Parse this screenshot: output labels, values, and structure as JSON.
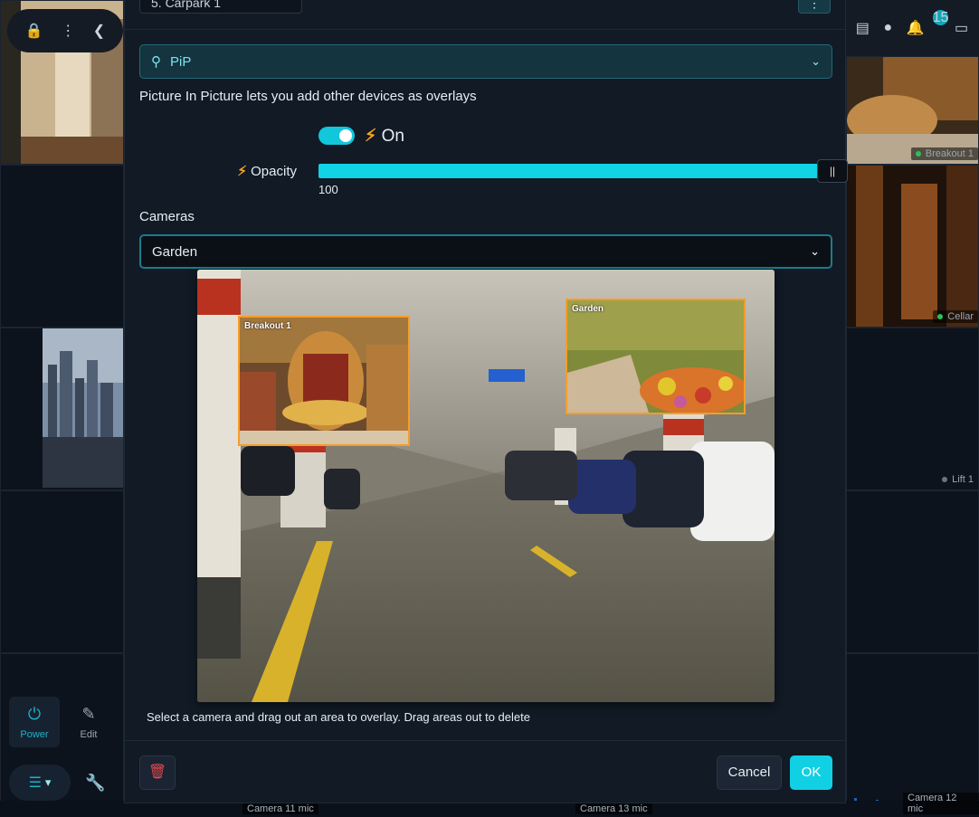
{
  "header": {
    "device_select_value": "5. Carpark 1",
    "more_label": "⋮"
  },
  "topbar": {
    "notification_count": "15"
  },
  "pip": {
    "search_value": "PiP",
    "description": "Picture In Picture lets you add other devices as overlays",
    "toggle_state": "On",
    "opacity_label": "Opacity",
    "opacity_value": "100",
    "opacity_fraction": 1.0,
    "cameras_label": "Cameras",
    "camera_selected": "Garden",
    "overlays": [
      {
        "title": "Breakout 1"
      },
      {
        "title": "Garden"
      }
    ],
    "help_text": "Select a camera and drag out an area to overlay. Drag areas out to delete"
  },
  "footer": {
    "cancel_label": "Cancel",
    "ok_label": "OK"
  },
  "background": {
    "tiles": [
      {
        "label": "Breakout 1"
      },
      {
        "label": "Cellar"
      },
      {
        "label": "Lift 1"
      }
    ],
    "left_actions": [
      {
        "label": "Power",
        "icon": "power-icon"
      },
      {
        "label": "Edit",
        "icon": "edit-icon"
      }
    ],
    "mic_labels": [
      "Camera 11 mic",
      "Camera 13 mic",
      "Camera 12 mic"
    ]
  },
  "colors": {
    "accent": "#12d0e3",
    "overlay_border": "#f59d2a",
    "danger": "#e5484d",
    "bolt": "#f5a524"
  }
}
